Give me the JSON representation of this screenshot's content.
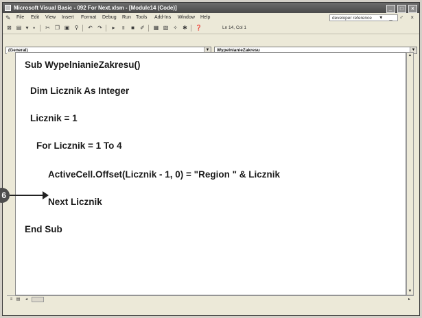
{
  "window": {
    "title": "Microsoft Visual Basic - 092 For Next.xlsm - [Module14 (Code)]",
    "controls": [
      "_",
      "□",
      "×"
    ]
  },
  "menu": {
    "items": [
      "File",
      "Edit",
      "View",
      "Insert",
      "Format",
      "Debug",
      "Run",
      "Tools",
      "Add-Ins",
      "Window",
      "Help"
    ],
    "help_box": "developer reference",
    "right_controls": "▾ _ ♂ ×"
  },
  "toolbar": {
    "status": "Ln 14, Col 1"
  },
  "combos": {
    "object": "(General)",
    "procedure": "WypelnianieZakresu"
  },
  "code": {
    "lines": [
      "Sub WypelnianieZakresu()",
      "Dim Licznik As Integer",
      "Licznik = 1",
      "For Licznik = 1 To 4",
      "ActiveCell.Offset(Licznik - 1, 0) = \"Region \" & Licznik",
      "Next Licznik",
      "End Sub"
    ]
  },
  "callout": {
    "number": "6"
  }
}
